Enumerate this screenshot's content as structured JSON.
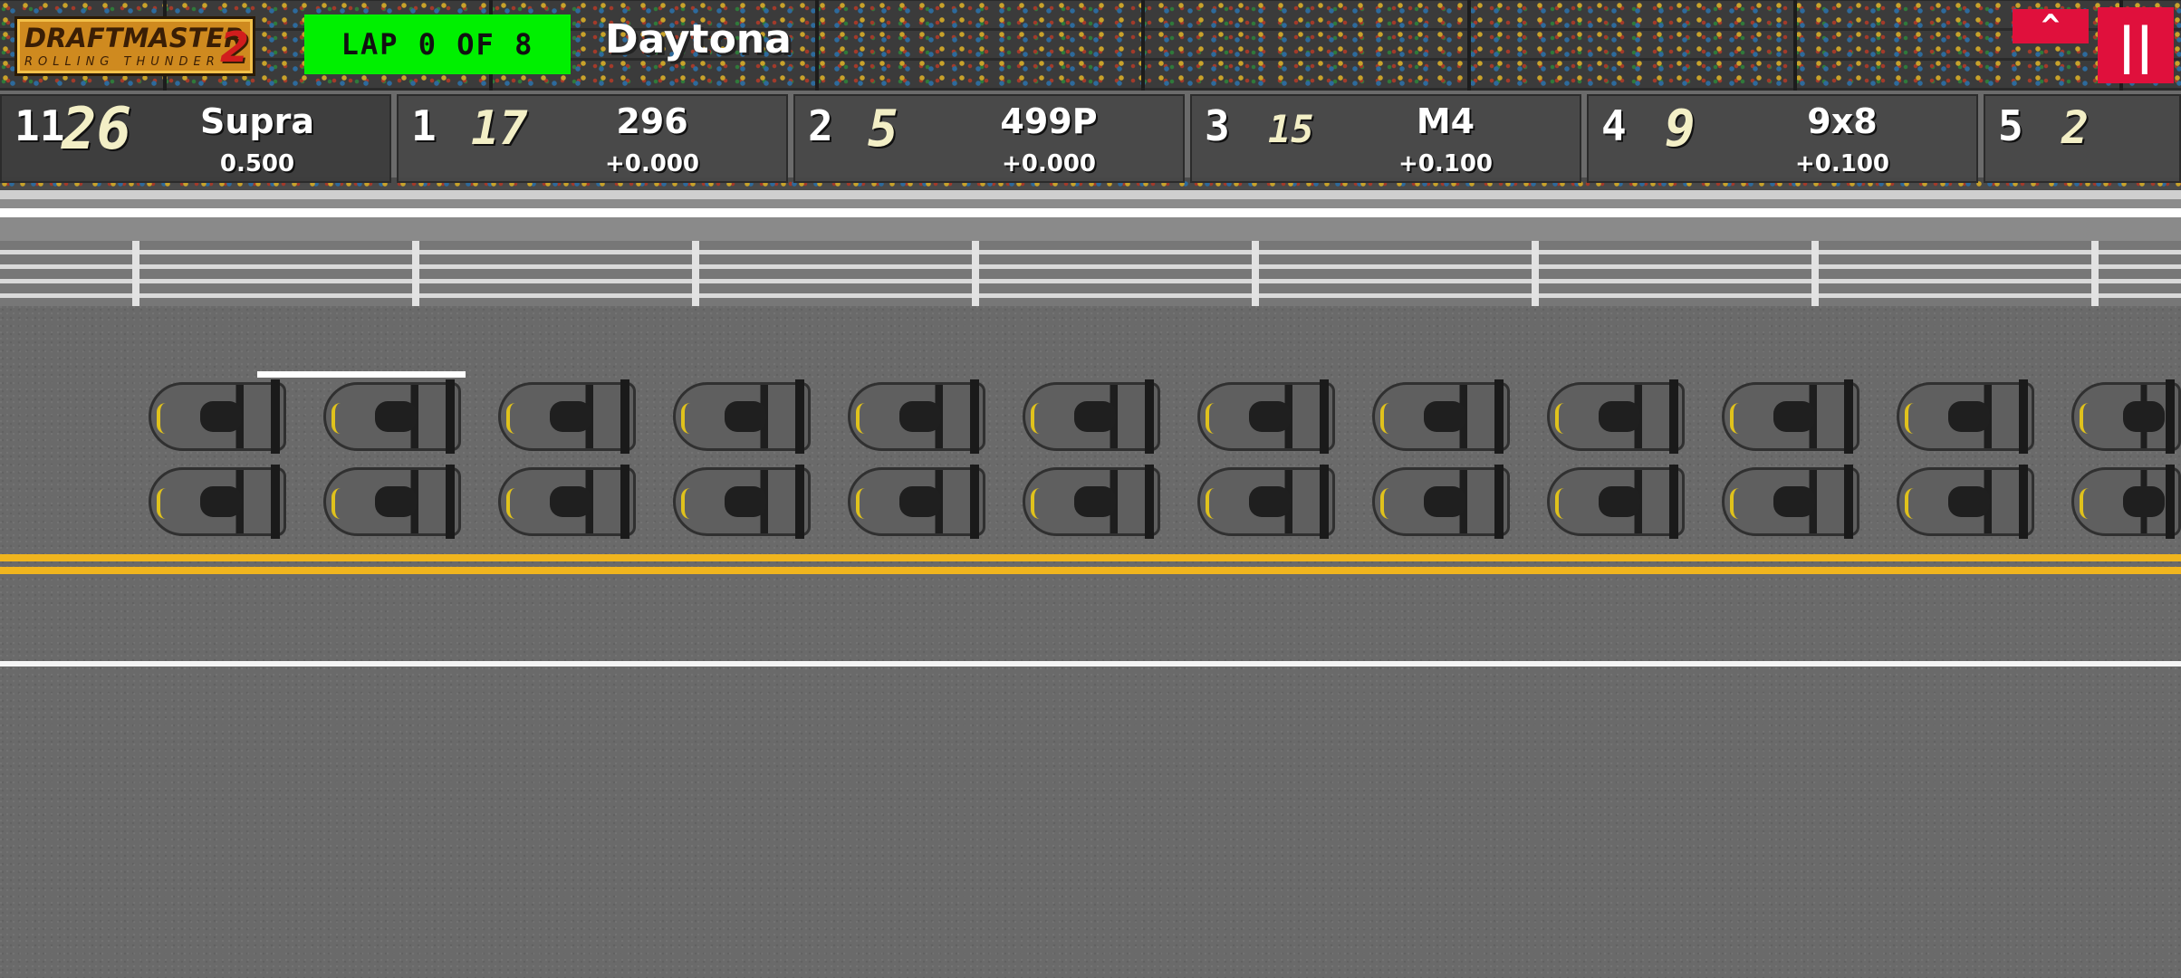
{
  "game": {
    "logo_main": "DRAFTMASTER",
    "logo_sub": "ROLLING THUNDER",
    "logo_num": "2",
    "lap_text": "LAP 0 OF 8",
    "track_name": "Daytona"
  },
  "controls": {
    "expand_label": "^",
    "pause_label": "||"
  },
  "standings": [
    {
      "pos": "11",
      "car_number": "26",
      "model": "Supra",
      "gap": "0.500"
    },
    {
      "pos": "1",
      "car_number": "17",
      "model": "296",
      "gap": "+0.000"
    },
    {
      "pos": "2",
      "car_number": "5",
      "model": "499P",
      "gap": "+0.000"
    },
    {
      "pos": "3",
      "car_number": "15",
      "model": "M4",
      "gap": "+0.100"
    },
    {
      "pos": "4",
      "car_number": "9",
      "model": "9x8",
      "gap": "+0.100"
    },
    {
      "pos": "5",
      "car_number": "2",
      "model": "",
      "gap": ""
    }
  ],
  "colors": {
    "lap_box": "#00f000",
    "button_red": "#e0103c",
    "track_line_yellow": "#f0b51e",
    "logo_orange": "#cf8a1f"
  }
}
